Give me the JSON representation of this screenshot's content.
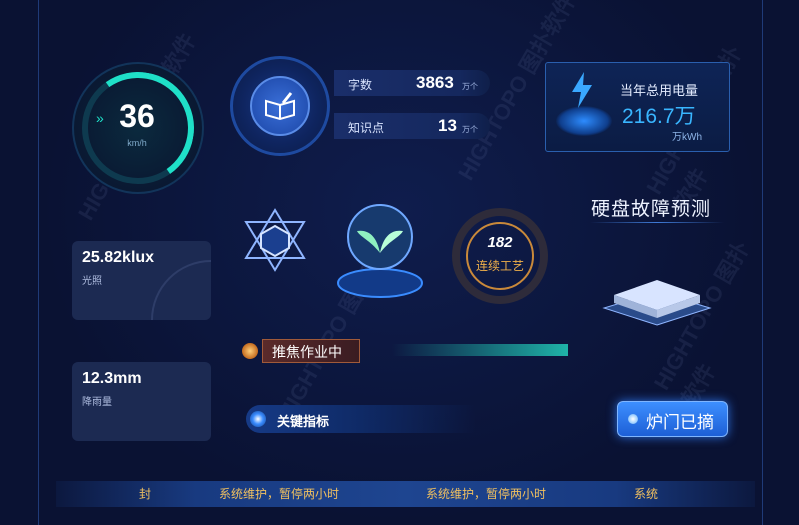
{
  "speed": {
    "value": "36",
    "unit": "km/h"
  },
  "stats": {
    "words_label": "字数",
    "words_value": "3863",
    "words_unit": "万个",
    "points_label": "知识点",
    "points_value": "13",
    "points_unit": "万个"
  },
  "power": {
    "title": "当年总用电量",
    "value": "216.7万",
    "unit": "万kWh"
  },
  "light": {
    "value": "25.82klux",
    "label": "光照"
  },
  "rain": {
    "value": "12.3mm",
    "label": "降雨量"
  },
  "disk": {
    "title": "硬盘故障预测"
  },
  "process": {
    "value": "182",
    "label": "连续工艺"
  },
  "focus": {
    "label": "推焦作业中"
  },
  "key_metric": {
    "label": "关键指标"
  },
  "door": {
    "label": "炉门已摘"
  },
  "marquee": {
    "items": [
      "封",
      "系统维护，暂停两小时",
      "系统维护，暂停两小时",
      "系统"
    ]
  },
  "watermark": {
    "text": "HIGHTOPO 图扑软件"
  },
  "colors": {
    "accent": "#1fe0c8",
    "blue": "#39b6ff",
    "gold": "#f0b04a"
  }
}
